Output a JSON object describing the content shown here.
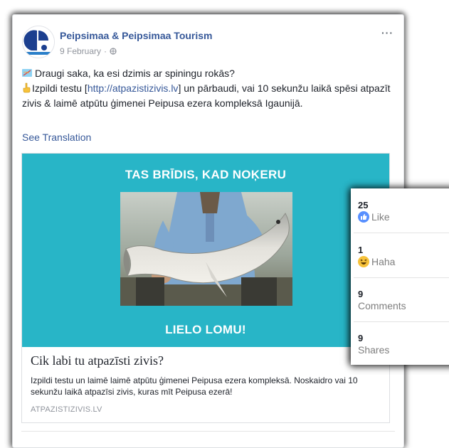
{
  "post": {
    "page_name": "Peipsimaa & Peipsimaa Tourism",
    "date": "9 February",
    "privacy_icon": "globe-icon",
    "more_label": "···",
    "text_line1": "Draugi saka, ka esi dzimis ar spiningu rokās?",
    "text_line2_pre": "Izpildi testu [",
    "text_link": "http://atpazistizivis.lv",
    "text_line2_post": "] un pārbaudi, vai 10 sekunžu laikā spēsi atpazīt zivis & laimē atpūtu ģimenei Peipusa ezera kompleksā Igaunijā.",
    "see_translation": "See Translation"
  },
  "card": {
    "headline_top": "TAS BRĪDIS, KAD NOĶERU",
    "headline_bottom": "LIELO LOMU!",
    "title": "Cik labi tu atpazīsti zivis?",
    "description": "Izpildi testu un laimē laimē atpūtu ģimenei Peipusa ezera kompleksā. Noskaidro vai 10 sekunžu laikā atpazīsi zivis, kuras mīt Peipusa ezerā!",
    "domain": "ATPAZISTIZIVIS.LV",
    "image_bg": "#28b5c7"
  },
  "stats": {
    "likes_count": "25",
    "likes_label": "Like",
    "haha_count": "1",
    "haha_label": "Haha",
    "comments_count": "9",
    "comments_label": "Comments",
    "shares_count": "9",
    "shares_label": "Shares"
  },
  "colors": {
    "link": "#365899",
    "like_blue": "#5890ff",
    "haha_yellow": "#f7c23a"
  }
}
